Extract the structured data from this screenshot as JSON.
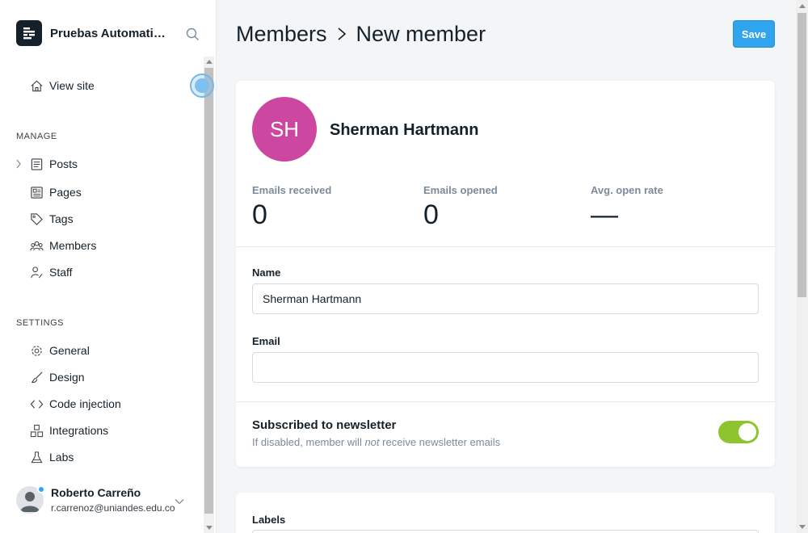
{
  "sidebar": {
    "site_name": "Pruebas Automatizadas",
    "view_site": "View site",
    "manage_title": "MANAGE",
    "manage_items": [
      {
        "label": "Posts",
        "icon": "posts-icon"
      },
      {
        "label": "Pages",
        "icon": "pages-icon"
      },
      {
        "label": "Tags",
        "icon": "tag-icon"
      },
      {
        "label": "Members",
        "icon": "members-icon"
      },
      {
        "label": "Staff",
        "icon": "staff-icon"
      }
    ],
    "settings_title": "SETTINGS",
    "settings_items": [
      {
        "label": "General",
        "icon": "gear-icon"
      },
      {
        "label": "Design",
        "icon": "brush-icon"
      },
      {
        "label": "Code injection",
        "icon": "code-icon"
      },
      {
        "label": "Integrations",
        "icon": "integrations-icon"
      },
      {
        "label": "Labs",
        "icon": "flask-icon"
      }
    ],
    "user": {
      "name": "Roberto Carreño",
      "email": "r.carrenoz@uniandes.edu.co"
    }
  },
  "header": {
    "breadcrumb_parent": "Members",
    "breadcrumb_current": "New member",
    "save_label": "Save"
  },
  "member": {
    "initials": "SH",
    "name": "Sherman Hartmann",
    "avatar_color": "#cc479f",
    "stats": [
      {
        "label": "Emails received",
        "value": "0"
      },
      {
        "label": "Emails opened",
        "value": "0"
      },
      {
        "label": "Avg. open rate",
        "value": "—"
      }
    ]
  },
  "form": {
    "name_label": "Name",
    "name_value": "Sherman Hartmann",
    "email_label": "Email",
    "email_value": "",
    "newsletter_title": "Subscribed to newsletter",
    "newsletter_sub_before": "If disabled, member will ",
    "newsletter_sub_em": "not",
    "newsletter_sub_after": " receive newsletter emails",
    "newsletter_enabled": true,
    "labels_label": "Labels"
  },
  "colors": {
    "accent": "#30a4ec",
    "toggle_on": "#8ec52f"
  }
}
